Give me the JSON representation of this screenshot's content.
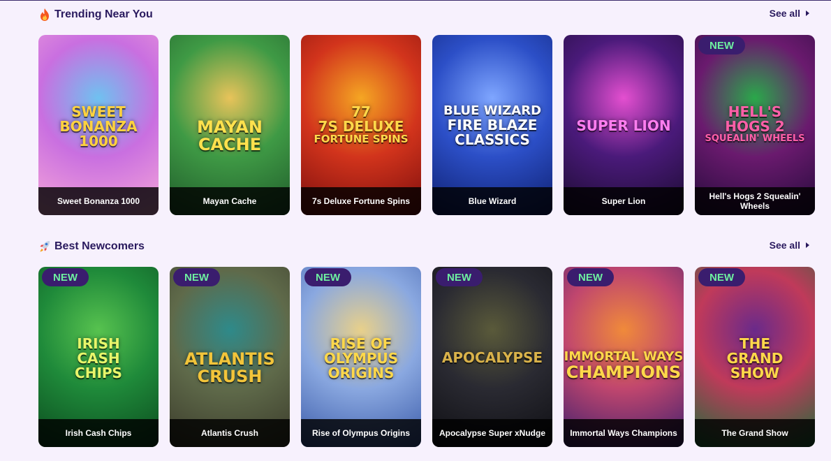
{
  "trending": {
    "title": "Trending Near You",
    "title_icon": "fire-icon",
    "see_all": "See all",
    "games": [
      {
        "name": "Sweet Bonanza 1000",
        "logo_lines": [
          "Sweet",
          "Bonanza",
          "1000"
        ],
        "new": false,
        "colors": [
          "#f7a8d8",
          "#c96fe0",
          "#6fc1f0"
        ],
        "logo_color": "#ffd23f"
      },
      {
        "name": "Mayan Cache",
        "logo_lines": [
          "Mayan",
          "Cache"
        ],
        "new": false,
        "colors": [
          "#1f5a2a",
          "#3f9a45",
          "#e8c35a"
        ],
        "logo_color": "#ffe14d"
      },
      {
        "name": "7s Deluxe Fortune Spins",
        "logo_lines": [
          "77",
          "7s Deluxe",
          "Fortune Spins"
        ],
        "new": false,
        "colors": [
          "#7a0d0d",
          "#d2341c",
          "#f5a623"
        ],
        "logo_color": "#ffd84a"
      },
      {
        "name": "Blue Wizard",
        "logo_lines": [
          "Blue Wizard",
          "Fire Blaze",
          "Classics"
        ],
        "new": false,
        "colors": [
          "#0e1f6e",
          "#2c4fc7",
          "#7fa6ff"
        ],
        "logo_color": "#ffffff"
      },
      {
        "name": "Super Lion",
        "logo_lines": [
          "Super Lion"
        ],
        "new": false,
        "colors": [
          "#1a0b2e",
          "#4a1a7a",
          "#e44fd0"
        ],
        "logo_color": "#ff7ef0"
      },
      {
        "name": "Hell's Hogs 2 Squealin' Wheels",
        "logo_lines": [
          "Hell's",
          "Hogs 2",
          "Squealin' Wheels"
        ],
        "new": true,
        "colors": [
          "#230b3a",
          "#6a1a6e",
          "#2aa84a"
        ],
        "logo_color": "#ff5fa8"
      }
    ]
  },
  "newcomers": {
    "title": "Best Newcomers",
    "title_icon": "rocket-icon",
    "see_all": "See all",
    "games": [
      {
        "name": "Irish Cash Chips",
        "logo_lines": [
          "Irish",
          "Cash",
          "Chips"
        ],
        "new": true,
        "colors": [
          "#0b4a1e",
          "#1f8a3a",
          "#57c24f"
        ],
        "logo_color": "#e8f56a"
      },
      {
        "name": "Atlantis Crush",
        "logo_lines": [
          "Atlantis",
          "Crush"
        ],
        "new": true,
        "colors": [
          "#3a3a2a",
          "#5f6a4a",
          "#2e8a8a"
        ],
        "logo_color": "#f2c43a"
      },
      {
        "name": "Rise of Olympus Origins",
        "logo_lines": [
          "Rise of",
          "Olympus",
          "Origins"
        ],
        "new": true,
        "colors": [
          "#3a5aa8",
          "#8aa8e0",
          "#e8d08a"
        ],
        "logo_color": "#ffd84a"
      },
      {
        "name": "Apocalypse Super xNudge",
        "logo_lines": [
          "Apocalypse"
        ],
        "new": true,
        "colors": [
          "#0e0e12",
          "#2a2a32",
          "#5a5a3a"
        ],
        "logo_color": "#d9b24a"
      },
      {
        "name": "Immortal Ways Champions",
        "logo_lines": [
          "Immortal Ways",
          "Champions"
        ],
        "new": true,
        "colors": [
          "#3a1f6e",
          "#c0466e",
          "#f08a3a"
        ],
        "logo_color": "#ffd84a"
      },
      {
        "name": "The Grand Show",
        "logo_lines": [
          "The",
          "Grand",
          "Show"
        ],
        "new": true,
        "colors": [
          "#1a6e3a",
          "#c03a5a",
          "#6a2a8a"
        ],
        "logo_color": "#ffd84a"
      }
    ],
    "badge_label": "NEW"
  },
  "badge_label": "NEW"
}
